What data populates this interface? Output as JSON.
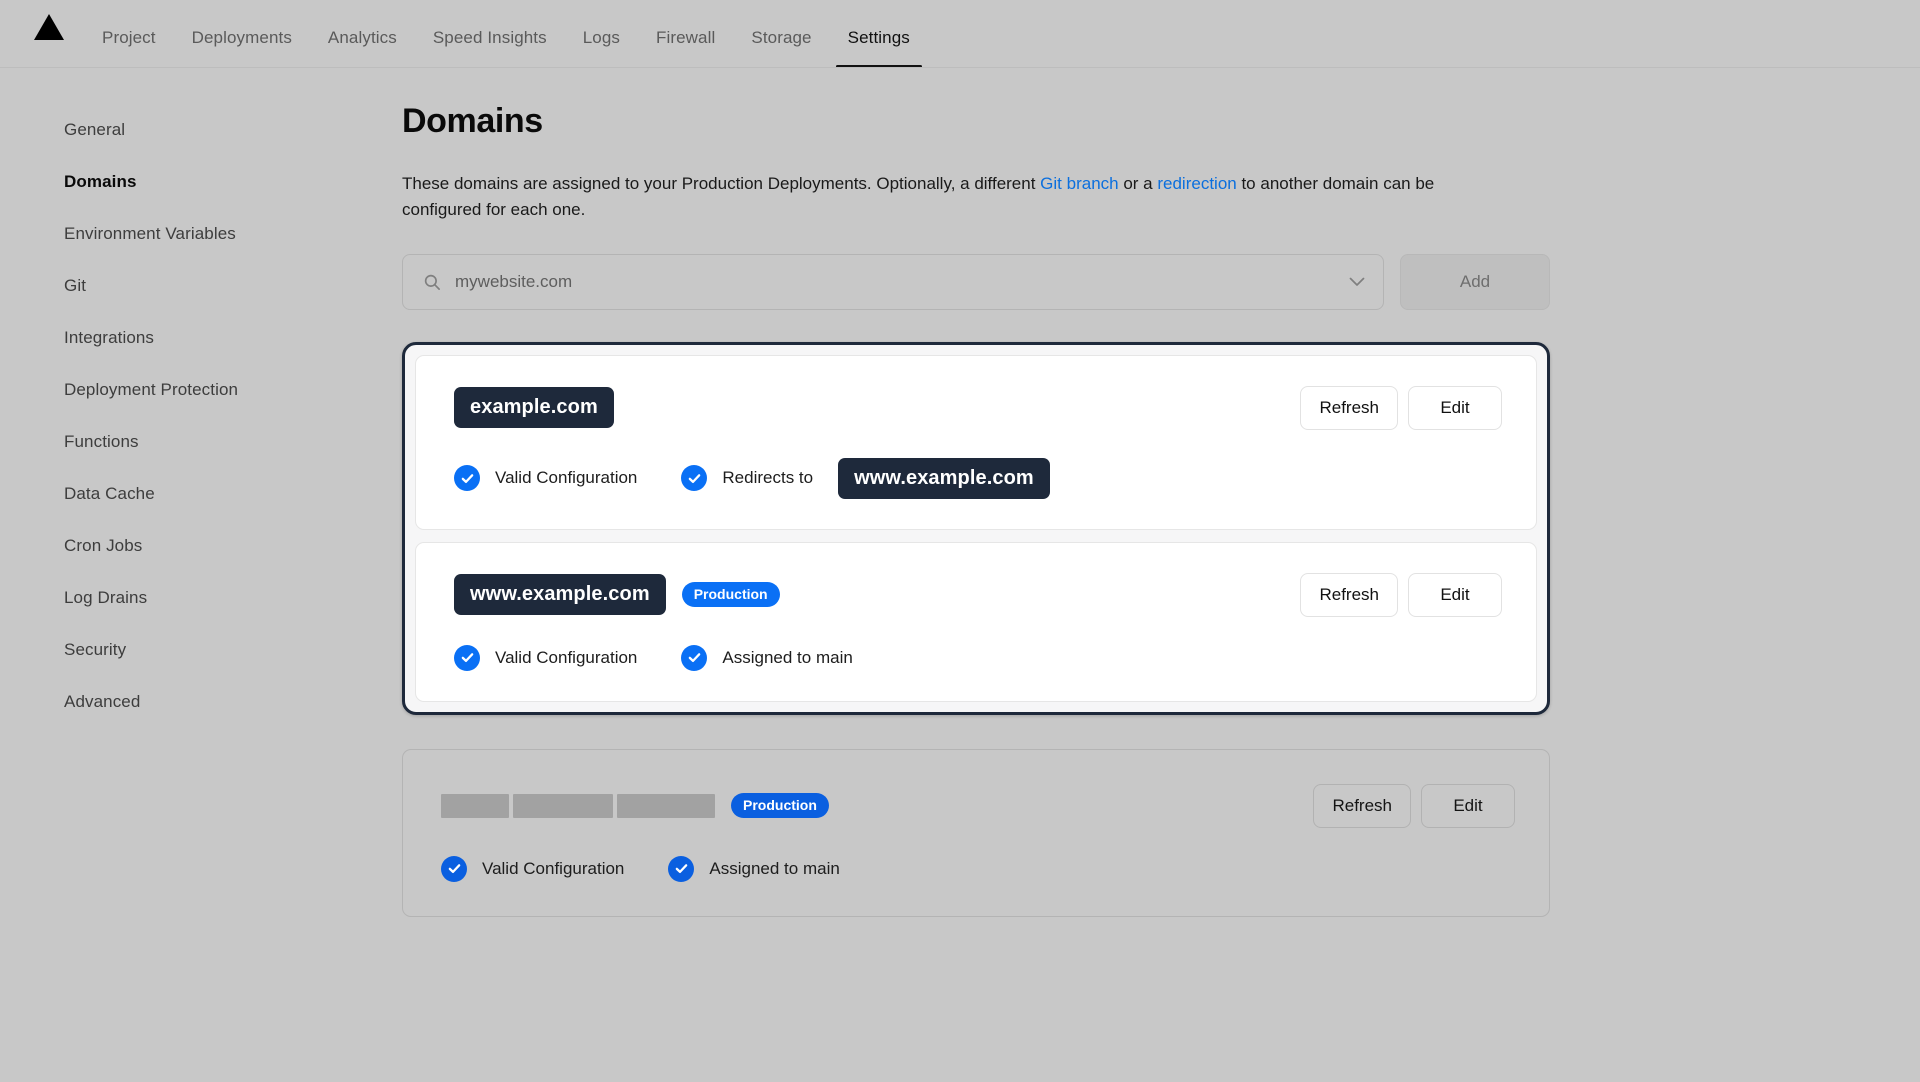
{
  "topnav": {
    "logo": "triangle-logo",
    "items": [
      {
        "label": "Project",
        "active": false
      },
      {
        "label": "Deployments",
        "active": false
      },
      {
        "label": "Analytics",
        "active": false
      },
      {
        "label": "Speed Insights",
        "active": false
      },
      {
        "label": "Logs",
        "active": false
      },
      {
        "label": "Firewall",
        "active": false
      },
      {
        "label": "Storage",
        "active": false
      },
      {
        "label": "Settings",
        "active": true
      }
    ]
  },
  "sidebar": {
    "items": [
      {
        "label": "General",
        "active": false
      },
      {
        "label": "Domains",
        "active": true
      },
      {
        "label": "Environment Variables",
        "active": false
      },
      {
        "label": "Git",
        "active": false
      },
      {
        "label": "Integrations",
        "active": false
      },
      {
        "label": "Deployment Protection",
        "active": false
      },
      {
        "label": "Functions",
        "active": false
      },
      {
        "label": "Data Cache",
        "active": false
      },
      {
        "label": "Cron Jobs",
        "active": false
      },
      {
        "label": "Log Drains",
        "active": false
      },
      {
        "label": "Security",
        "active": false
      },
      {
        "label": "Advanced",
        "active": false
      }
    ]
  },
  "main": {
    "title": "Domains",
    "description": {
      "part1": "These domains are assigned to your Production Deployments. Optionally, a different ",
      "link1": "Git branch",
      "part2": " or a ",
      "link2": "redirection",
      "part3": " to another domain can be configured for each one."
    },
    "search": {
      "placeholder": "mywebsite.com",
      "value": "",
      "icon": "search-icon",
      "dropdown_icon": "chevron-down-icon"
    },
    "add_button": "Add",
    "cards": [
      {
        "domain": "example.com",
        "badge": null,
        "redacted": false,
        "status": [
          {
            "label": "Valid Configuration",
            "icon": "check-circle-icon"
          }
        ],
        "redirect": {
          "label": "Redirects to",
          "target": "www.example.com",
          "icon": "check-circle-icon"
        },
        "actions": {
          "refresh": "Refresh",
          "edit": "Edit"
        }
      },
      {
        "domain": "www.example.com",
        "badge": "Production",
        "redacted": false,
        "status": [
          {
            "label": "Valid Configuration",
            "icon": "check-circle-icon"
          },
          {
            "label": "Assigned to main",
            "icon": "check-circle-icon"
          }
        ],
        "redirect": null,
        "actions": {
          "refresh": "Refresh",
          "edit": "Edit"
        }
      },
      {
        "domain": "",
        "badge": "Production",
        "redacted": true,
        "status": [
          {
            "label": "Valid Configuration",
            "icon": "check-circle-icon"
          },
          {
            "label": "Assigned to main",
            "icon": "check-circle-icon"
          }
        ],
        "redirect": null,
        "actions": {
          "refresh": "Refresh",
          "edit": "Edit"
        }
      }
    ]
  },
  "colors": {
    "page_bg": "#c8c8c8",
    "accent_blue": "#0a70f5",
    "link_blue": "#0b6fde",
    "pill_dark": "#1e293b",
    "focus_ring": "#1e293b",
    "card_bg": "#ffffff"
  }
}
